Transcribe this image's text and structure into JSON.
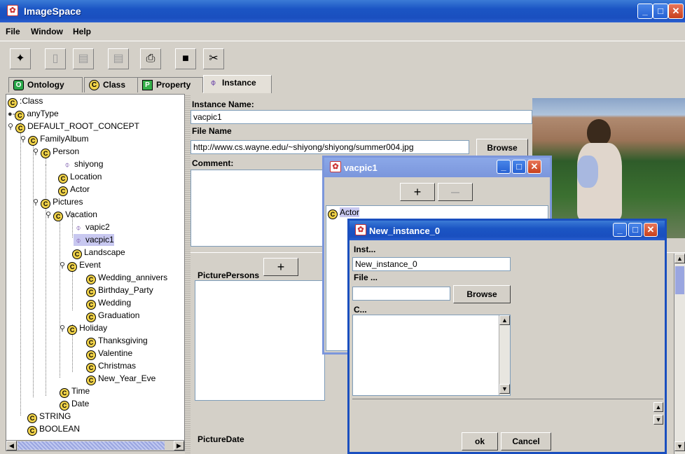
{
  "window": {
    "title": "ImageSpace"
  },
  "menu": [
    "File",
    "Window",
    "Help"
  ],
  "tabs": [
    {
      "label": "Ontology",
      "badge": "O"
    },
    {
      "label": "Class",
      "badge": "C"
    },
    {
      "label": "Property",
      "badge": "P"
    },
    {
      "label": "Instance",
      "badge": "I"
    }
  ],
  "tree": {
    "root": ":Class",
    "items": [
      "anyType",
      "DEFAULT_ROOT_CONCEPT",
      "FamilyAlbum",
      "Person",
      "shiyong",
      "Location",
      "Actor",
      "Pictures",
      "Vacation",
      "vapic2",
      "vacpic1",
      "Landscape",
      "Event",
      "Wedding_annivers",
      "Birthday_Party",
      "Wedding",
      "Graduation",
      "Holiday",
      "Thanksgiving",
      "Valentine",
      "Christmas",
      "New_Year_Eve",
      "Time",
      "Date",
      "STRING",
      "BOOLEAN"
    ]
  },
  "form": {
    "instance_name_label": "Instance Name:",
    "instance_name_value": "vacpic1",
    "file_name_label": "File Name",
    "file_name_value": "http://www.cs.wayne.edu/~shiyong/shiyong/summer004.jpg",
    "browse_label": "Browse",
    "comment_label": "Comment:",
    "picture_persons_label": "PicturePersons",
    "picture_date_label": "PictureDate",
    "plus_label": "+",
    "minus_label": "—"
  },
  "dialog_vacpic": {
    "title": "vacpic1",
    "plus_label": "+",
    "minus_label": "—",
    "list_item": "Actor"
  },
  "dialog_new": {
    "title": "New_instance_0",
    "inst_label": "Inst...",
    "inst_value": "New_instance_0",
    "file_label": "File ...",
    "file_value": "",
    "browse_label": "Browse",
    "comment_label": "C...",
    "ok_label": "ok",
    "cancel_label": "Cancel"
  }
}
